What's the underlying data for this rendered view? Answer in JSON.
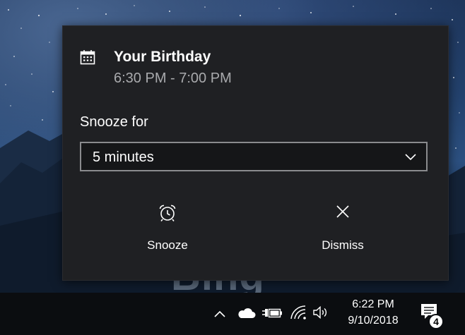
{
  "desktop": {
    "watermark_text": "Bing"
  },
  "toast": {
    "app_icon": "calendar-icon",
    "title": "Your Birthday",
    "time_range": "6:30 PM - 7:00 PM",
    "snooze_label": "Snooze for",
    "snooze_selected": "5 minutes",
    "actions": [
      {
        "label": "Snooze",
        "icon": "alarm-clock-icon"
      },
      {
        "label": "Dismiss",
        "icon": "close-icon"
      }
    ],
    "colors": {
      "background": "#1f2023",
      "title": "#ffffff",
      "secondary_text": "#a9aaad",
      "select_border": "#8a8b8e"
    }
  },
  "taskbar": {
    "tray_icons": [
      "chevron-up-icon",
      "onedrive-cloud-icon",
      "battery-plug-icon",
      "wifi-icon",
      "volume-icon"
    ],
    "clock_time": "6:22 PM",
    "clock_date": "9/10/2018",
    "notification_count": "4",
    "notification_icon": "action-center-icon"
  }
}
